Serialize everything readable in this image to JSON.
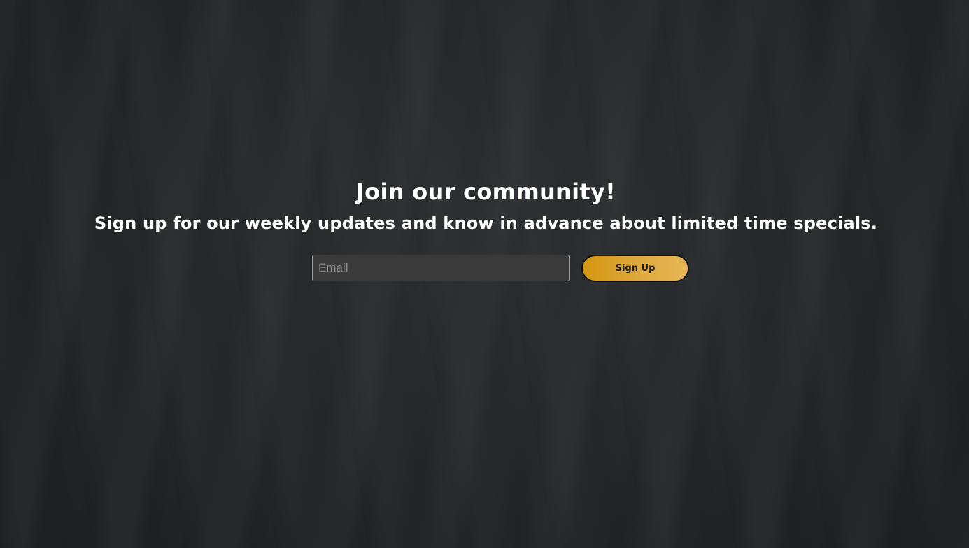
{
  "signup": {
    "heading": "Join our community!",
    "subheading": "Sign up for our weekly updates and know in advance about limited time specials.",
    "email_placeholder": "Email",
    "email_value": "",
    "button_label": "Sign Up"
  },
  "colors": {
    "background": "#25282a",
    "text": "#ffffff",
    "button_gradient_start": "#d4960f",
    "button_gradient_end": "#e7b757",
    "input_background": "#3a3a3a"
  }
}
